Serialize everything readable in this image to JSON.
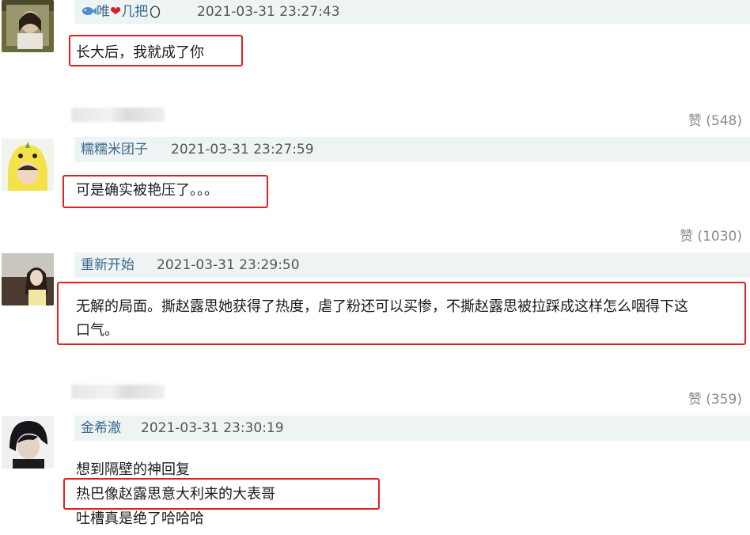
{
  "comments": [
    {
      "user": "唯",
      "user_suffix": "几把",
      "timestamp": "2021-03-31 23:27:43",
      "lines": [
        "长大后，我就成了你"
      ],
      "likes": "赞 (548)"
    },
    {
      "user": "糯糯米团子",
      "timestamp": "2021-03-31 23:27:59",
      "lines": [
        "可是确实被艳压了。。。"
      ],
      "likes": "赞 (1030)"
    },
    {
      "user": "重新开始",
      "timestamp": "2021-03-31 23:29:50",
      "lines": [
        "无解的局面。撕赵露思她获得了热度，虐了粉还可以买惨，不撕赵露思被拉踩成这样怎么咽得下这",
        "口气。"
      ],
      "likes": "赞 (359)"
    },
    {
      "user": "金希澈",
      "timestamp": "2021-03-31 23:30:19",
      "lines": [
        "想到隔壁的神回复",
        "热巴像赵露思意大利来的大表哥",
        "吐槽真是绝了哈哈哈"
      ]
    }
  ],
  "colors": {
    "highlight_box": "#e02020",
    "username": "#3a6a8c",
    "header_bg": "#eef3f4"
  },
  "icons": [
    "fish-icon",
    "heart-icon",
    "egg-icon"
  ]
}
